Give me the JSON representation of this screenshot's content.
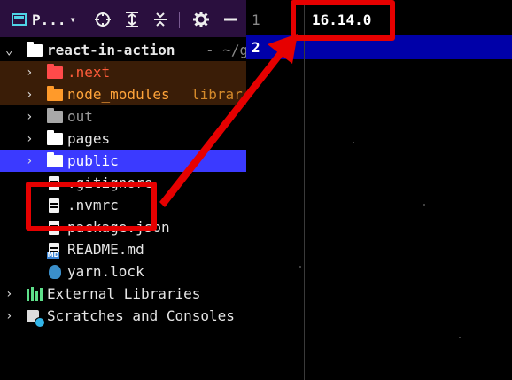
{
  "toolbar": {
    "title": "P...",
    "caret": "▾",
    "icons": [
      "crosshair-icon",
      "expand-all-icon",
      "collapse-all-icon",
      "gear-icon",
      "minimize-icon"
    ]
  },
  "tree": {
    "root": {
      "label": "react-in-action",
      "path_hint": "- ~/g"
    },
    "items": [
      {
        "label": ".next",
        "kind": "folder",
        "color": "#ff4a4a"
      },
      {
        "label": "node_modules",
        "kind": "folder",
        "suffix": "librar",
        "color": "#ff9a2a"
      },
      {
        "label": "out",
        "kind": "folder",
        "color": "#a8a8a8"
      },
      {
        "label": "pages",
        "kind": "folder"
      },
      {
        "label": "public",
        "kind": "folder",
        "selected": true
      },
      {
        "label": ".gitignore",
        "kind": "file"
      },
      {
        "label": ".nvmrc",
        "kind": "file"
      },
      {
        "label": "package.json",
        "kind": "file"
      },
      {
        "label": "README.md",
        "kind": "file"
      },
      {
        "label": "yarn.lock",
        "kind": "file"
      }
    ],
    "external_libraries": "External Libraries",
    "scratches": "Scratches and Consoles"
  },
  "editor": {
    "line_numbers": [
      "1",
      "2"
    ],
    "lines": [
      "16.14.0",
      ""
    ],
    "current_line": 2
  },
  "colors": {
    "annotation": "#e60000",
    "selection": "#3b3aff",
    "current_line_bg": "#0000a8",
    "toolbar_bg": "#2a0f3e"
  }
}
